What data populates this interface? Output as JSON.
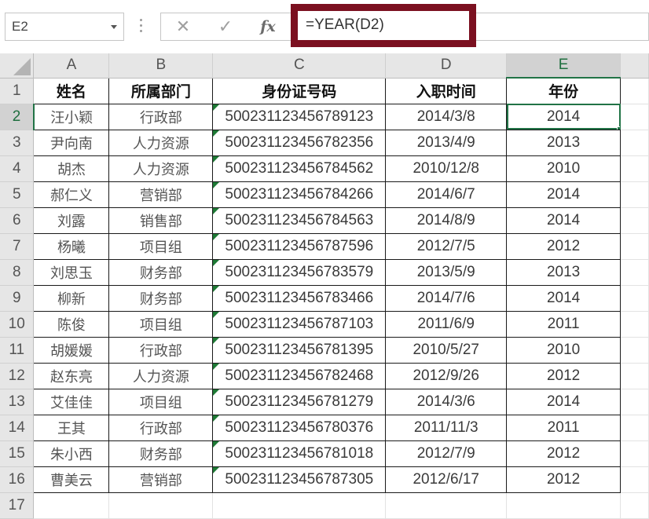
{
  "name_box": {
    "value": "E2"
  },
  "formula_bar": {
    "cancel_glyph": "✕",
    "enter_glyph": "✓",
    "fx_label": "fx",
    "formula": "=YEAR(D2)"
  },
  "columns": [
    "A",
    "B",
    "C",
    "D",
    "E"
  ],
  "row_numbers": [
    "1",
    "2",
    "3",
    "4",
    "5",
    "6",
    "7",
    "8",
    "9",
    "10",
    "11",
    "12",
    "13",
    "14",
    "15",
    "16",
    "17"
  ],
  "table": {
    "headers": [
      "姓名",
      "所属部门",
      "身份证号码",
      "入职时间",
      "年份"
    ],
    "rows": [
      [
        "汪小颖",
        "行政部",
        "500231123456789123",
        "2014/3/8",
        "2014"
      ],
      [
        "尹向南",
        "人力资源",
        "500231123456782356",
        "2013/4/9",
        "2013"
      ],
      [
        "胡杰",
        "人力资源",
        "500231123456784562",
        "2010/12/8",
        "2010"
      ],
      [
        "郝仁义",
        "营销部",
        "500231123456784266",
        "2014/6/7",
        "2014"
      ],
      [
        "刘露",
        "销售部",
        "500231123456784563",
        "2014/8/9",
        "2014"
      ],
      [
        "杨曦",
        "项目组",
        "500231123456787596",
        "2012/7/5",
        "2012"
      ],
      [
        "刘思玉",
        "财务部",
        "500231123456783579",
        "2013/5/9",
        "2013"
      ],
      [
        "柳新",
        "财务部",
        "500231123456783466",
        "2014/7/6",
        "2014"
      ],
      [
        "陈俊",
        "项目组",
        "500231123456787103",
        "2011/6/9",
        "2011"
      ],
      [
        "胡媛媛",
        "行政部",
        "500231123456781395",
        "2010/5/27",
        "2010"
      ],
      [
        "赵东亮",
        "人力资源",
        "500231123456782468",
        "2012/9/26",
        "2012"
      ],
      [
        "艾佳佳",
        "项目组",
        "500231123456781279",
        "2014/3/6",
        "2014"
      ],
      [
        "王其",
        "行政部",
        "500231123456780376",
        "2011/11/3",
        "2011"
      ],
      [
        "朱小西",
        "财务部",
        "500231123456781018",
        "2012/7/9",
        "2012"
      ],
      [
        "曹美云",
        "营销部",
        "500231123456787305",
        "2012/6/17",
        "2012"
      ]
    ]
  },
  "colors": {
    "formula_highlight_border": "#7b1020",
    "selection_green": "#217346",
    "header_bg": "#e6e6e6",
    "error_indicator_green": "#1e7a35"
  }
}
